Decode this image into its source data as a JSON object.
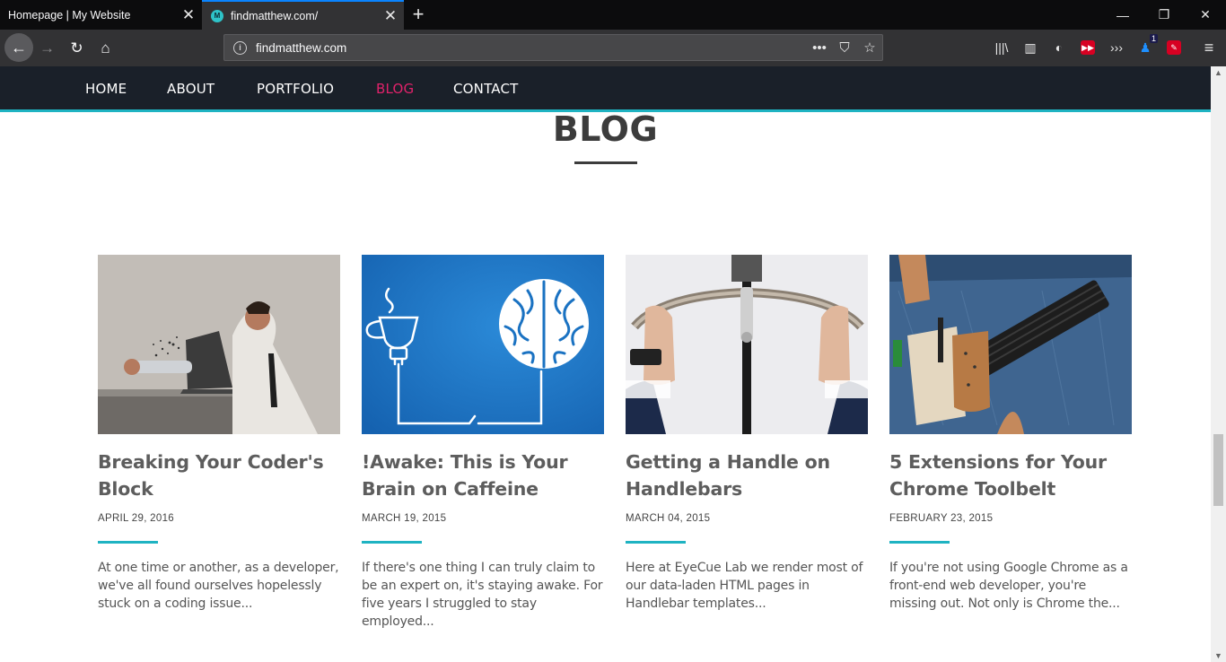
{
  "browser": {
    "tabs": [
      {
        "title": "Homepage | My Website",
        "active": false
      },
      {
        "title": "findmatthew.com/",
        "active": true
      }
    ],
    "favicon_letter": "M",
    "url": "findmatthew.com",
    "new_tab_glyph": "+",
    "close_glyph": "✕",
    "badge_count": "1",
    "icons": {
      "back": "←",
      "forward": "→",
      "reload": "↻",
      "home": "⌂",
      "page_actions": "•••",
      "pocket": "⛉",
      "bookmark": "☆",
      "library": "|||\\",
      "sidebar": "▥",
      "ext1": "◐",
      "ext2": "▶▶",
      "ext3": "›››",
      "ext4": "♟",
      "ext5": "✎",
      "menu": "≡",
      "minimize": "—",
      "restore": "❐",
      "close_window": "✕"
    }
  },
  "site": {
    "nav": [
      {
        "label": "HOME",
        "active": false
      },
      {
        "label": "ABOUT",
        "active": false
      },
      {
        "label": "PORTFOLIO",
        "active": false
      },
      {
        "label": "BLOG",
        "active": true
      },
      {
        "label": "CONTACT",
        "active": false
      }
    ],
    "section_title": "BLOG",
    "accent_color": "#1fb3c2",
    "active_color": "#e0226a",
    "posts": [
      {
        "title": "Breaking Your Coder's Block",
        "date": "APRIL 29, 2016",
        "excerpt": "At one time or another, as a developer, we've all found ourselves hopelessly stuck on a coding issue..."
      },
      {
        "title": "!Awake: This is Your Brain on Caffeine",
        "date": "MARCH 19, 2015",
        "excerpt": "If there's one thing I can truly claim to be an expert on, it's staying awake. For five years I struggled to stay employed..."
      },
      {
        "title": "Getting a Handle on Handlebars",
        "date": "MARCH 04, 2015",
        "excerpt": "Here at EyeCue Lab we render most of our data-laden HTML pages in Handlebar templates..."
      },
      {
        "title": "5 Extensions for Your Chrome Toolbelt",
        "date": "FEBRUARY 23, 2015",
        "excerpt": "If you're not using Google Chrome as a front-end web developer, you're missing out. Not only is Chrome the..."
      }
    ]
  }
}
